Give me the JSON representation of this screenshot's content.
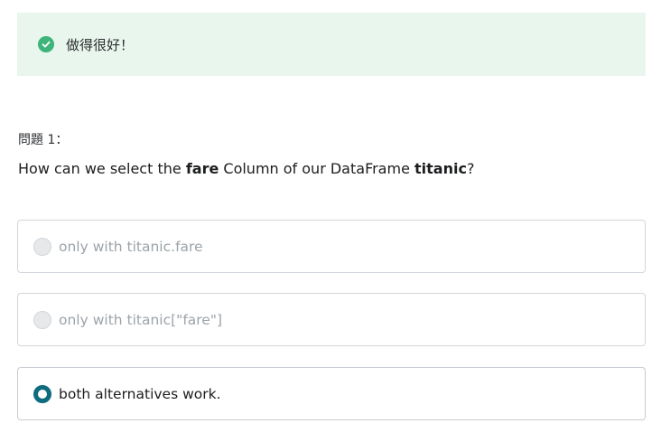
{
  "feedback": {
    "icon": "check-circle-icon",
    "message": "做得很好！",
    "color": "#3db47a",
    "background": "#e9f6ee"
  },
  "question": {
    "label": "問題 1：",
    "text_before_fare": "How can we select the ",
    "fare_word": "fare",
    "text_middle": " Column of our DataFrame ",
    "titanic_word": "titanic",
    "text_end": "?"
  },
  "options": [
    {
      "label": "only with titanic.fare",
      "selected": false
    },
    {
      "label": "only with titanic[\"fare\"]",
      "selected": false
    },
    {
      "label": "both alternatives work.",
      "selected": true
    }
  ],
  "accent_color": "#0f6b7e"
}
